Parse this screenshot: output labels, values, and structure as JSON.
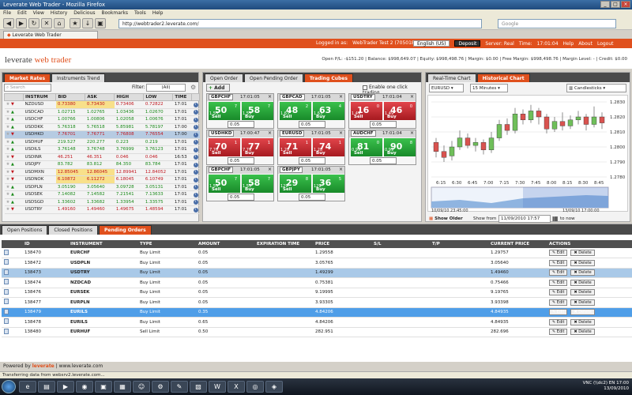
{
  "window": {
    "title": "Leverate Web Trader - Mozilla Firefox"
  },
  "menu": [
    "File",
    "Edit",
    "View",
    "History",
    "Delicious",
    "Bookmarks",
    "Tools",
    "Help"
  ],
  "browser": {
    "url": "http://webtrader2.leverate.com/",
    "search_placeholder": "Google",
    "tab": "Leverate Web Trader"
  },
  "topbar": {
    "logged": "Logged in as:",
    "user": "WebTrader Test 2 (705018)",
    "lang": "English (US)",
    "deposit": "Deposit",
    "server": "Server: Real",
    "time_label": "Time:",
    "time": "17:01:04",
    "help": "Help",
    "about": "About",
    "logout": "Logout"
  },
  "header": {
    "logo_a": "leverate",
    "logo_b": "web trader",
    "account": "Open P/L: -$151.20  |  Balance: $998,649.07  |  Equity: $998,498.76  |  Margin: $0.00  |  Free Margin: $998,498.76  |  Margin Level: -  |  Credit: $0.00"
  },
  "market": {
    "tabs": [
      "Market Rates",
      "Instruments Trend"
    ],
    "search": "Search",
    "filter_label": "Filter:",
    "filter_value": "(All)",
    "headers": [
      "INSTRUM",
      "BID",
      "ASK",
      "HIGH",
      "LOW",
      "TIME"
    ],
    "rows": [
      {
        "s": "NZDUSD",
        "b": "0.73380",
        "a": "0.73430",
        "h": "0.73406",
        "l": "0.72822",
        "t": "17:01",
        "d": "dn",
        "hl": true
      },
      {
        "s": "USDCAD",
        "b": "1.02715",
        "a": "1.02765",
        "h": "1.03436",
        "l": "1.02670",
        "t": "17:01",
        "d": "up"
      },
      {
        "s": "USDCHF",
        "b": "1.00766",
        "a": "1.00806",
        "h": "1.02058",
        "l": "1.00676",
        "t": "17:01",
        "d": "up"
      },
      {
        "s": "USDDKK",
        "b": "5.76318",
        "a": "5.76518",
        "h": "5.85981",
        "l": "5.78197",
        "t": "17:00",
        "d": "up"
      },
      {
        "s": "USDHKD",
        "b": "7.76701",
        "a": "7.76771",
        "h": "7.76808",
        "l": "7.76554",
        "t": "17:00",
        "d": "dn",
        "sel": true
      },
      {
        "s": "USDHUF",
        "b": "219.527",
        "a": "220.277",
        "h": "0.223",
        "l": "0.219",
        "t": "17:01",
        "d": "up"
      },
      {
        "s": "USDILS",
        "b": "3.76148",
        "a": "3.76748",
        "h": "3.76999",
        "l": "3.76123",
        "t": "17:01",
        "d": "up"
      },
      {
        "s": "USDINR",
        "b": "46.251",
        "a": "46.351",
        "h": "0.046",
        "l": "0.046",
        "t": "16:53",
        "d": "dn"
      },
      {
        "s": "USDJPY",
        "b": "83.782",
        "a": "83.812",
        "h": "84.350",
        "l": "83.784",
        "t": "17:01",
        "d": "up"
      },
      {
        "s": "USDMXN",
        "b": "12.85045",
        "a": "12.86045",
        "h": "12.89941",
        "l": "12.84052",
        "t": "17:01",
        "d": "dn",
        "hl": true
      },
      {
        "s": "USDNOK",
        "b": "6.10872",
        "a": "6.11272",
        "h": "6.18045",
        "l": "6.10749",
        "t": "17:01",
        "d": "dn",
        "hl": true
      },
      {
        "s": "USDPLN",
        "b": "3.05190",
        "a": "3.05640",
        "h": "3.09728",
        "l": "3.05131",
        "t": "17:01",
        "d": "up"
      },
      {
        "s": "USDSEK",
        "b": "7.14082",
        "a": "7.14582",
        "h": "7.21541",
        "l": "7.13633",
        "t": "17:01",
        "d": "up"
      },
      {
        "s": "USDSGD",
        "b": "1.33602",
        "a": "1.33682",
        "h": "1.33954",
        "l": "1.33575",
        "t": "17:01",
        "d": "up"
      },
      {
        "s": "USDTRY",
        "b": "1.49160",
        "a": "1.49460",
        "h": "1.49675",
        "l": "1.48594",
        "t": "17:01",
        "d": "dn"
      }
    ]
  },
  "trade": {
    "tabs": [
      "Open Order",
      "Open Pending Order",
      "Trading Cubes"
    ],
    "add": "Add",
    "oneclick": "Enable one click trading",
    "sell": "Sell",
    "buy": "Buy",
    "cubes": [
      {
        "s": "GBPCHF",
        "t": "17:01:05",
        "c": "g",
        "sb": "50",
        "ss": "1.55",
        "sp": "7",
        "bb": "58",
        "bs": "1.55",
        "bp": "7",
        "amt": "0.05"
      },
      {
        "s": "GBPCAD",
        "t": "17:01:05",
        "c": "g",
        "sb": "48",
        "ss": "1.63",
        "sp": "2",
        "bb": "63",
        "bs": "1.63",
        "bp": "4",
        "amt": "0.05"
      },
      {
        "s": "USDTRY",
        "t": "17:01:04",
        "c": "r",
        "sb": "16",
        "ss": "1.49",
        "sp": "0",
        "bb": "46",
        "bs": "1.49",
        "bp": "0",
        "amt": "0.05"
      },
      {
        "s": "USDHKD",
        "t": "17:00:47",
        "c": "r",
        "sb": "70",
        "ss": "7.76",
        "sp": "1",
        "bb": "77",
        "bs": "7.76",
        "bp": "1",
        "amt": "0.05"
      },
      {
        "s": "EURUSD",
        "t": "17:01:05",
        "c": "r",
        "sb": "71",
        "ss": "1.28",
        "sp": "1",
        "bb": "74",
        "bs": "1.28",
        "bp": "1",
        "amt": "0.05"
      },
      {
        "s": "AUDCHF",
        "t": "17:01:04",
        "c": "g",
        "sb": "81",
        "ss": "0.99",
        "sp": "0",
        "bb": "90",
        "bs": "0.99",
        "bp": "8",
        "amt": "0.05"
      },
      {
        "s": "GBPCHF",
        "t": "17:01:05",
        "c": "g",
        "sb": "50",
        "ss": "1.55",
        "sp": "7",
        "bb": "58",
        "bs": "1.55",
        "bp": "7",
        "amt": "0.05"
      },
      {
        "s": "GBPJPY",
        "t": "17:01:05",
        "c": "g",
        "sb": "29",
        "ss": "129.",
        "sp": "8",
        "bb": "36",
        "bs": "129.",
        "bp": "5",
        "amt": "0.05"
      }
    ]
  },
  "chart": {
    "tabs": [
      "Real-Time Chart",
      "Historical Chart"
    ],
    "symbol": "EURUSD",
    "period": "15 Minutes",
    "type": "Candlesticks",
    "yticks": [
      "1.2830",
      "1.2820",
      "1.2810",
      "1.2800",
      "1.2790",
      "1.2780"
    ],
    "xticks": [
      "6:15",
      "6:30",
      "6:45",
      "7:00",
      "7:15",
      "7:30",
      "7:45",
      "8:00",
      "8:15",
      "8:30",
      "8:45"
    ],
    "range_start": "10/09/10 23:45:00",
    "range_end": "13/09/10 17:00:00",
    "show_older": "Show Older",
    "show_from": "Show from",
    "from_value": "11/09/2010 17:57",
    "to_now": "to now"
  },
  "orders": {
    "tabs": [
      "Open Positions",
      "Closed Positions",
      "Pending Orders"
    ],
    "headers": [
      "ID",
      "INSTRUMENT",
      "TYPE",
      "AMOUNT",
      "EXPIRATION TIME",
      "PRICE",
      "S/L",
      "T/P",
      "CURRENT PRICE",
      "ACTIONS"
    ],
    "edit": "Edit",
    "delete": "Delete",
    "rows": [
      {
        "id": "138470",
        "ins": "EURCHF",
        "type": "Buy Limit",
        "amt": "0.05",
        "exp": "",
        "price": "1.29558",
        "sl": "",
        "tp": "",
        "cur": "1.29757"
      },
      {
        "id": "138472",
        "ins": "USDPLN",
        "type": "Buy Limit",
        "amt": "0.05",
        "exp": "",
        "price": "3.05765",
        "sl": "",
        "tp": "",
        "cur": "3.05640"
      },
      {
        "id": "138473",
        "ins": "USDTRY",
        "type": "Buy Limit",
        "amt": "0.05",
        "exp": "",
        "price": "1.49299",
        "sl": "",
        "tp": "",
        "cur": "1.49460",
        "sel": 1
      },
      {
        "id": "138474",
        "ins": "NZDCAD",
        "type": "Buy Limit",
        "amt": "0.05",
        "exp": "",
        "price": "0.75381",
        "sl": "",
        "tp": "",
        "cur": "0.75466"
      },
      {
        "id": "138476",
        "ins": "EURSEK",
        "type": "Buy Limit",
        "amt": "0.05",
        "exp": "",
        "price": "9.19995",
        "sl": "",
        "tp": "",
        "cur": "9.19765"
      },
      {
        "id": "138477",
        "ins": "EURPLN",
        "type": "Buy Limit",
        "amt": "0.05",
        "exp": "",
        "price": "3.93305",
        "sl": "",
        "tp": "",
        "cur": "3.93398"
      },
      {
        "id": "138479",
        "ins": "EURILS",
        "type": "Buy Limit",
        "amt": "0.35",
        "exp": "",
        "price": "4.84206",
        "sl": "",
        "tp": "",
        "cur": "4.84935",
        "sel": 2
      },
      {
        "id": "138478",
        "ins": "EURILS",
        "type": "Buy Limit",
        "amt": "0.65",
        "exp": "",
        "price": "4.84206",
        "sl": "",
        "tp": "",
        "cur": "4.84935"
      },
      {
        "id": "138480",
        "ins": "EURHUF",
        "type": "Sell Limit",
        "amt": "0.50",
        "exp": "",
        "price": "282.951",
        "sl": "",
        "tp": "",
        "cur": "282.696"
      }
    ]
  },
  "footer": {
    "powered": "Powered by",
    "brand": "leverate",
    "site": "| www.leverate.com",
    "status": "Transferring data from websrv2.leverate.com...",
    "tray_left": "VNC (\\\\dc2)",
    "lang": "EN",
    "clock": "17:00",
    "date": "13/09/2010"
  }
}
